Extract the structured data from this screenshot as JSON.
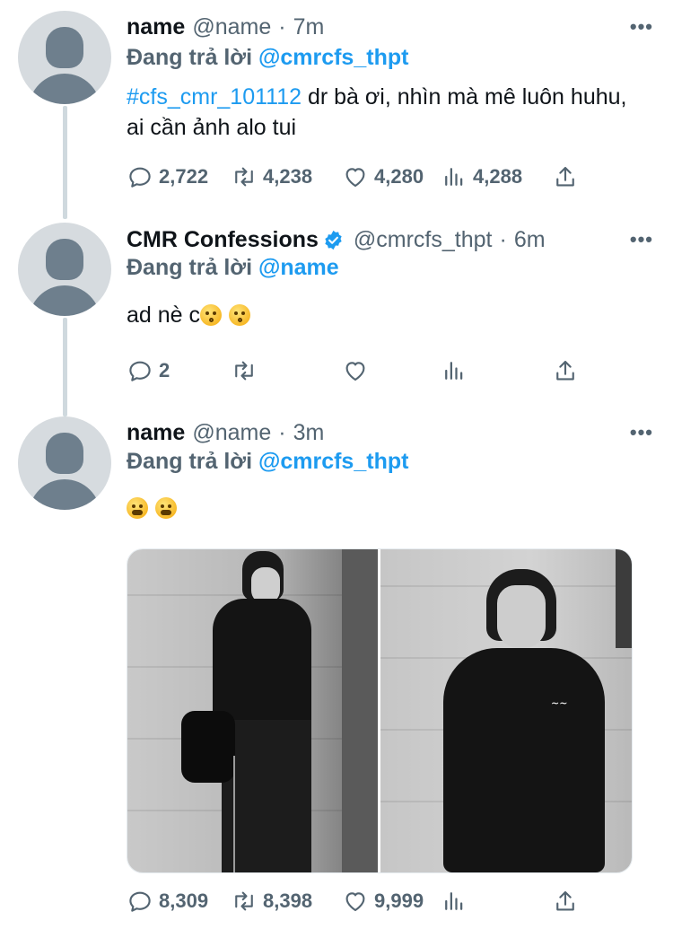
{
  "tweets": [
    {
      "display_name": "name",
      "handle": "@name",
      "time": "7m",
      "replying_prefix": "Đang trả lời",
      "replying_to": "@cmrcfs_thpt",
      "hashtag": "#cfs_cmr_101112",
      "text": " dr bà ơi, nhìn mà mê luôn huhu, ai cần ảnh alo tui",
      "replies": "2,722",
      "retweets": "4,238",
      "likes": "4,280",
      "views": "4,288"
    },
    {
      "display_name": "CMR Confessions",
      "verified": true,
      "handle": "@cmrcfs_thpt",
      "time": "6m",
      "replying_prefix": "Đang trả lời",
      "replying_to": "@name",
      "text": "ad nè c",
      "emojis": [
        "kissing-face",
        "kissing-face"
      ],
      "replies": "2",
      "retweets": "",
      "likes": "",
      "views": ""
    },
    {
      "display_name": "name",
      "handle": "@name",
      "time": "3m",
      "replying_prefix": "Đang trả lời",
      "replying_to": "@cmrcfs_thpt",
      "emojis": [
        "tired-face",
        "tired-face"
      ],
      "media": [
        "photo-left",
        "photo-right"
      ],
      "replies": "8,309",
      "retweets": "8,398",
      "likes": "9,999",
      "views": ""
    }
  ],
  "more_label": "•••",
  "separator": "·",
  "colors": {
    "link": "#1d9bf0",
    "muted": "#536471",
    "text": "#0f1419",
    "avatar_bg": "#d6dbdf",
    "avatar_fg": "#6e7f8d"
  },
  "icons": [
    "reply-icon",
    "retweet-icon",
    "like-icon",
    "views-icon",
    "share-icon",
    "verified-badge-icon",
    "more-icon"
  ]
}
